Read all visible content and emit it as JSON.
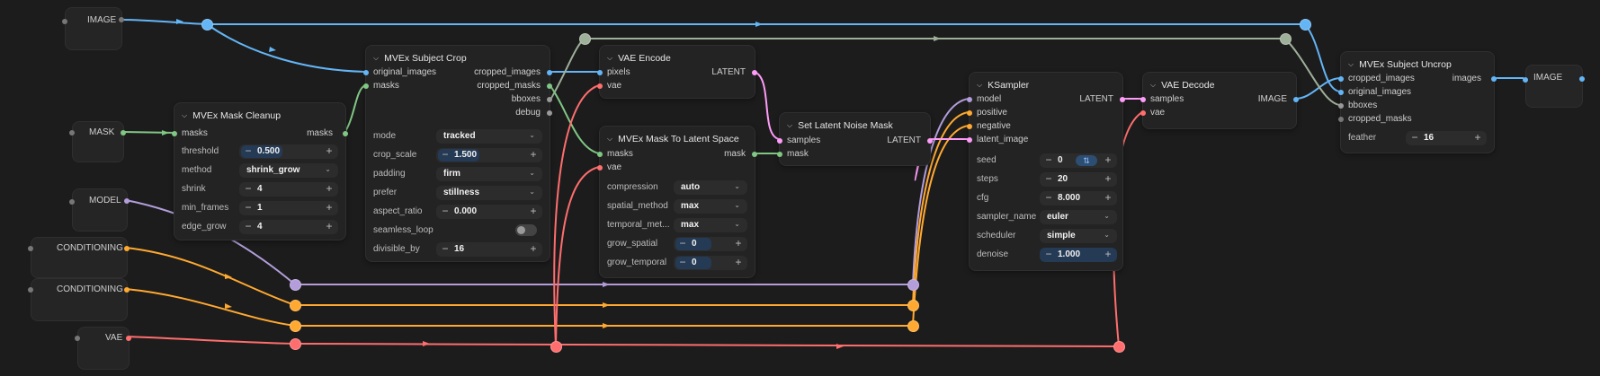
{
  "colors": {
    "image": "#64b5f6",
    "mask": "#81c784",
    "model": "#b39ddb",
    "conditioning": "#ffa931",
    "vae": "#ff6e6e",
    "latent": "#ff9cf9",
    "gray": "#9fb09a"
  },
  "inputs": {
    "image": "IMAGE",
    "mask": "MASK",
    "model": "MODEL",
    "conditioning1": "CONDITIONING",
    "conditioning2": "CONDITIONING",
    "vae": "VAE"
  },
  "output_image": "IMAGE",
  "mask_cleanup": {
    "title": "MVEx Mask Cleanup",
    "in_masks": "masks",
    "out_masks": "masks",
    "threshold_label": "threshold",
    "threshold": "0.500",
    "method_label": "method",
    "method": "shrink_grow",
    "shrink_label": "shrink",
    "shrink": "4",
    "min_frames_label": "min_frames",
    "min_frames": "1",
    "edge_grow_label": "edge_grow",
    "edge_grow": "4"
  },
  "subject_crop": {
    "title": "MVEx Subject Crop",
    "in_original_images": "original_images",
    "in_masks": "masks",
    "out_cropped_images": "cropped_images",
    "out_cropped_masks": "cropped_masks",
    "out_bboxes": "bboxes",
    "out_debug": "debug",
    "mode_label": "mode",
    "mode": "tracked",
    "crop_scale_label": "crop_scale",
    "crop_scale": "1.500",
    "padding_label": "padding",
    "padding": "firm",
    "prefer_label": "prefer",
    "prefer": "stillness",
    "aspect_ratio_label": "aspect_ratio",
    "aspect_ratio": "0.000",
    "seamless_loop_label": "seamless_loop",
    "divisible_by_label": "divisible_by",
    "divisible_by": "16"
  },
  "vae_encode": {
    "title": "VAE Encode",
    "in_pixels": "pixels",
    "in_vae": "vae",
    "out_latent": "LATENT"
  },
  "mask_to_latent": {
    "title": "MVEx Mask To Latent Space",
    "in_masks": "masks",
    "in_vae": "vae",
    "out_mask": "mask",
    "compression_label": "compression",
    "compression": "auto",
    "spatial_method_label": "spatial_method",
    "spatial_method": "max",
    "temporal_method_label": "temporal_met...",
    "temporal_method": "max",
    "grow_spatial_label": "grow_spatial",
    "grow_spatial": "0",
    "grow_temporal_label": "grow_temporal",
    "grow_temporal": "0"
  },
  "set_latent_noise_mask": {
    "title": "Set Latent Noise Mask",
    "in_samples": "samples",
    "in_mask": "mask",
    "out_latent": "LATENT"
  },
  "ksampler": {
    "title": "KSampler",
    "in_model": "model",
    "in_positive": "positive",
    "in_negative": "negative",
    "in_latent_image": "latent_image",
    "out_latent": "LATENT",
    "seed_label": "seed",
    "seed": "0",
    "steps_label": "steps",
    "steps": "20",
    "cfg_label": "cfg",
    "cfg": "8.000",
    "sampler_name_label": "sampler_name",
    "sampler_name": "euler",
    "scheduler_label": "scheduler",
    "scheduler": "simple",
    "denoise_label": "denoise",
    "denoise": "1.000"
  },
  "vae_decode": {
    "title": "VAE Decode",
    "in_samples": "samples",
    "in_vae": "vae",
    "out_image": "IMAGE"
  },
  "subject_uncrop": {
    "title": "MVEx Subject Uncrop",
    "in_cropped_images": "cropped_images",
    "in_original_images": "original_images",
    "in_bboxes": "bboxes",
    "in_cropped_masks": "cropped_masks",
    "out_images": "images",
    "feather_label": "feather",
    "feather": "16"
  }
}
